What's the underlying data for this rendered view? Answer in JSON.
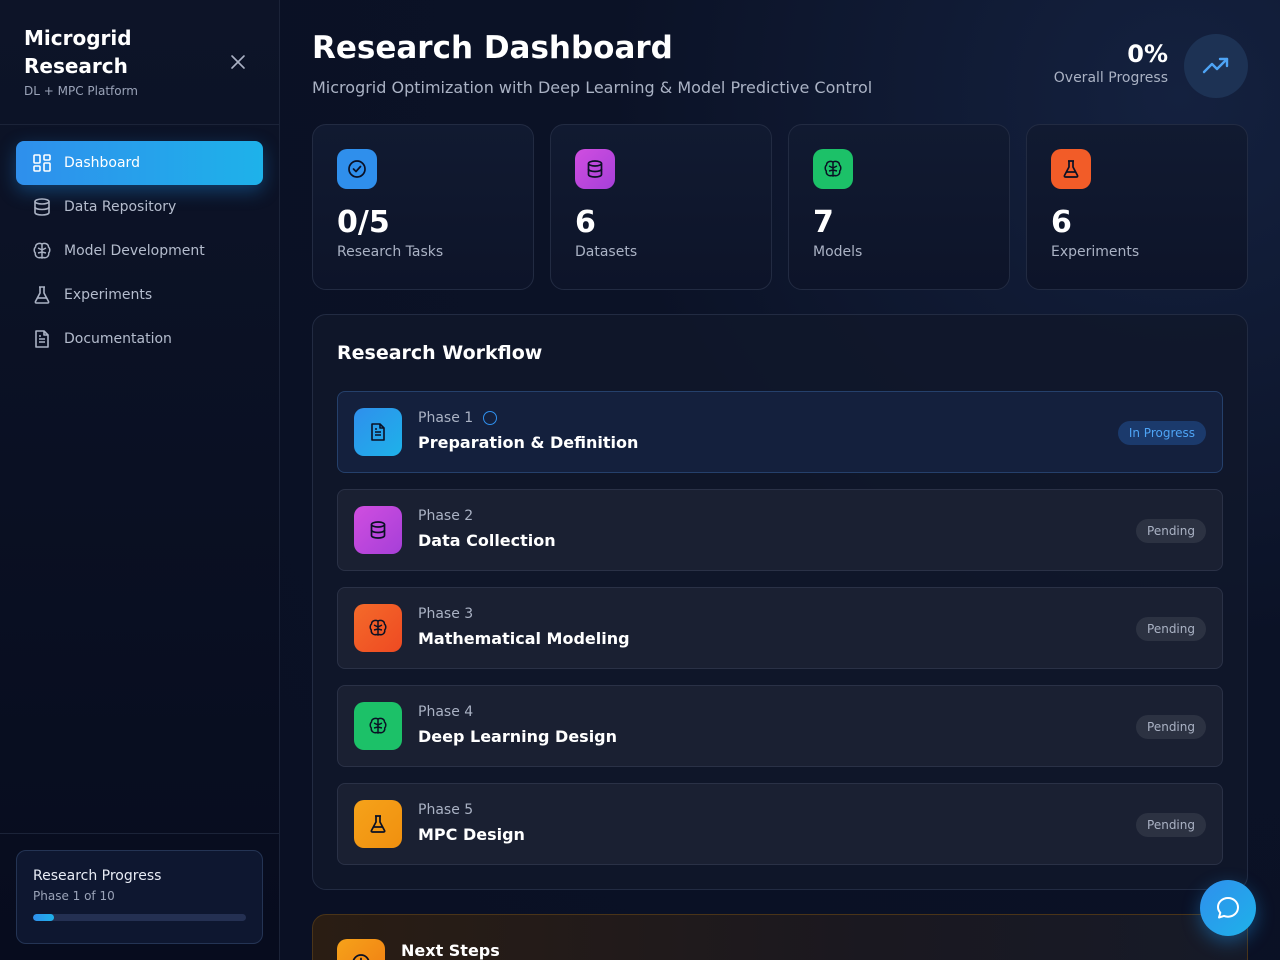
{
  "sidebar": {
    "title": "Microgrid Research",
    "subtitle": "DL + MPC Platform",
    "nav": [
      {
        "label": "Dashboard",
        "icon": "layout-grid-icon",
        "active": true
      },
      {
        "label": "Data Repository",
        "icon": "database-icon"
      },
      {
        "label": "Model Development",
        "icon": "brain-icon"
      },
      {
        "label": "Experiments",
        "icon": "flask-icon"
      },
      {
        "label": "Documentation",
        "icon": "file-text-icon"
      }
    ],
    "progress": {
      "title": "Research Progress",
      "subtitle": "Phase 1 of 10",
      "fraction": 0.1
    }
  },
  "header": {
    "title": "Research Dashboard",
    "subtitle": "Microgrid Optimization with Deep Learning & Model Predictive Control",
    "overall_value": "0%",
    "overall_label": "Overall Progress"
  },
  "stats": [
    {
      "value": "0/5",
      "label": "Research Tasks",
      "icon": "check-circle-icon",
      "color": "#2f8fec"
    },
    {
      "value": "6",
      "label": "Datasets",
      "icon": "database-icon",
      "color": "#c44be0"
    },
    {
      "value": "7",
      "label": "Models",
      "icon": "brain-icon",
      "color": "#1cc168"
    },
    {
      "value": "6",
      "label": "Experiments",
      "icon": "flask-icon",
      "color": "#f25c28"
    }
  ],
  "workflow": {
    "title": "Research Workflow",
    "phases": [
      {
        "number": "Phase 1",
        "name": "Preparation & Definition",
        "status": "In Progress",
        "icon": "file-text-icon"
      },
      {
        "number": "Phase 2",
        "name": "Data Collection",
        "status": "Pending",
        "icon": "database-icon"
      },
      {
        "number": "Phase 3",
        "name": "Mathematical Modeling",
        "status": "Pending",
        "icon": "brain-icon"
      },
      {
        "number": "Phase 4",
        "name": "Deep Learning Design",
        "status": "Pending",
        "icon": "brain-icon"
      },
      {
        "number": "Phase 5",
        "name": "MPC Design",
        "status": "Pending",
        "icon": "flask-icon"
      }
    ]
  },
  "next_steps": {
    "title": "Next Steps"
  }
}
